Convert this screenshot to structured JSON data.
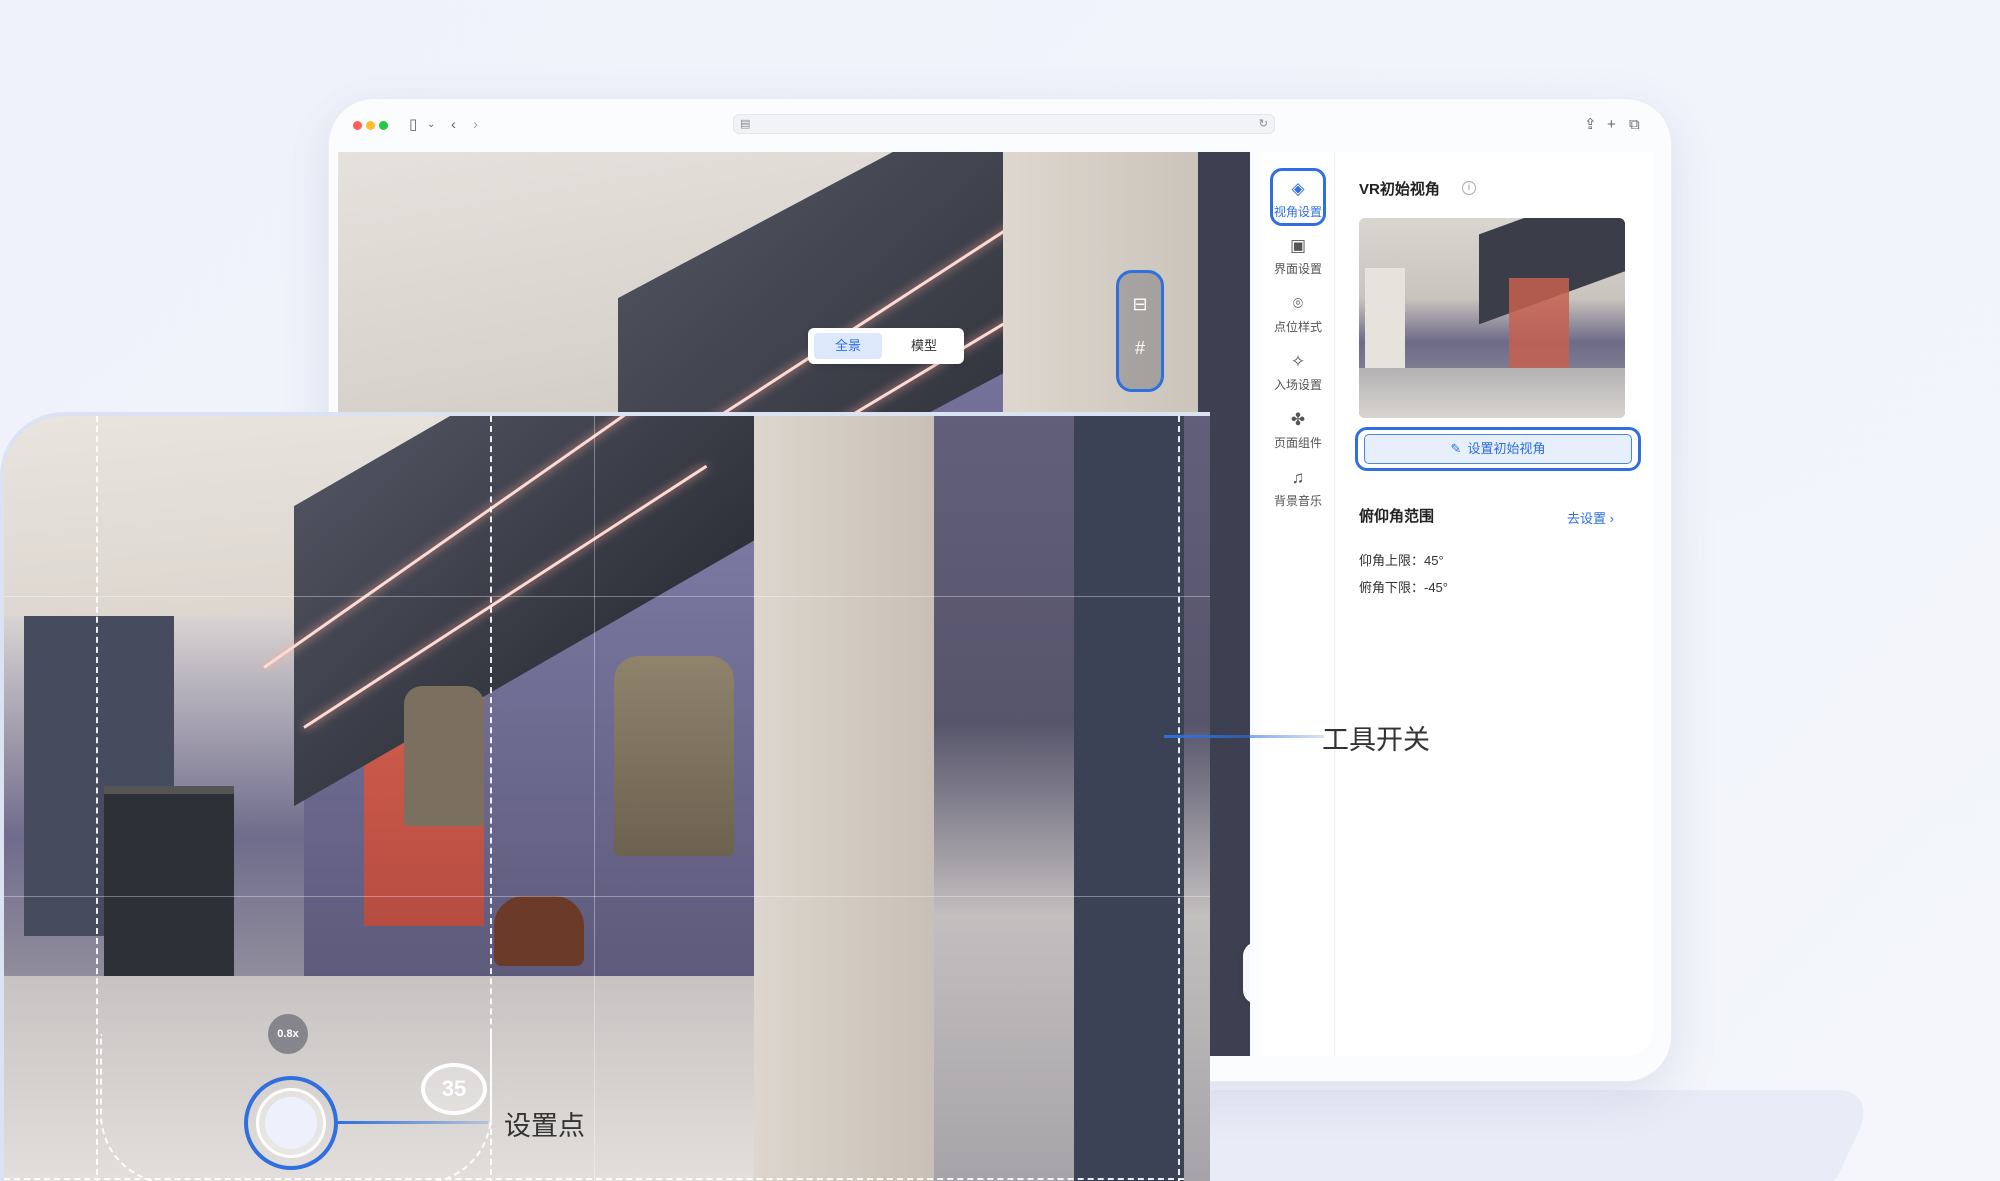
{
  "scene_tabs": {
    "panorama": "全景",
    "model": "模型"
  },
  "rail": [
    {
      "label": "视角设置",
      "icon": "view-angle-icon"
    },
    {
      "label": "界面设置",
      "icon": "interface-icon"
    },
    {
      "label": "点位样式",
      "icon": "location-pin-icon"
    },
    {
      "label": "入场设置",
      "icon": "sparkle-icon"
    },
    {
      "label": "页面组件",
      "icon": "puzzle-icon"
    },
    {
      "label": "背景音乐",
      "icon": "music-note-icon"
    }
  ],
  "panel": {
    "title": "VR初始视角",
    "set_button": "设置初始视角",
    "pitch_title": "俯仰角范围",
    "pitch_link": "去设置",
    "upper_limit": "仰角上限：45°",
    "lower_limit": "俯角下限：-45°"
  },
  "phone": {
    "zoom": "0.8x",
    "count": "35",
    "tool_label": "工具开关",
    "point_label": "设置点"
  },
  "colors": {
    "accent": "#2f6fe0",
    "callout_text": "#333333"
  }
}
